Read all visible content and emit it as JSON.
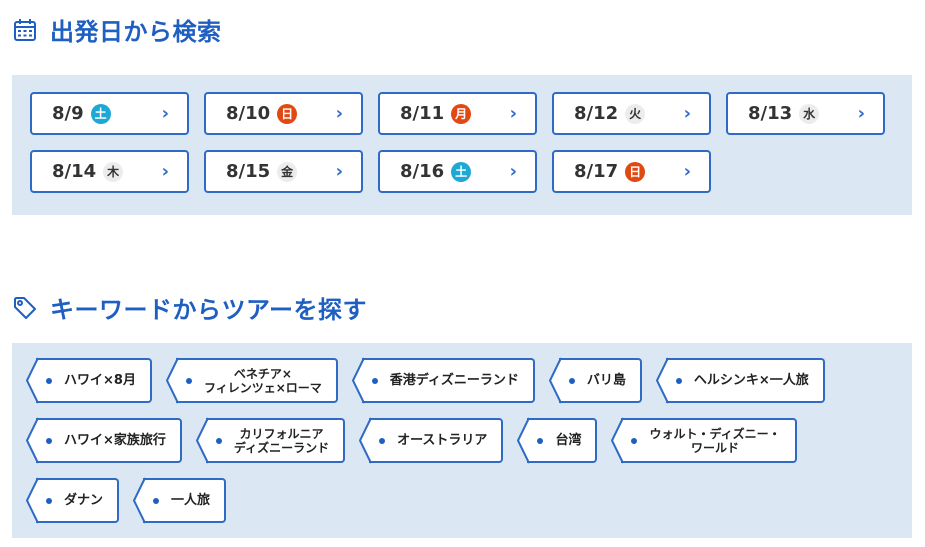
{
  "date_section": {
    "title": "出発日から検索",
    "icon": "calendar-icon",
    "dates": [
      {
        "date": "8/9",
        "dow": "土",
        "type": "sat"
      },
      {
        "date": "8/10",
        "dow": "日",
        "type": "sun"
      },
      {
        "date": "8/11",
        "dow": "月",
        "type": "sun"
      },
      {
        "date": "8/12",
        "dow": "火",
        "type": "wk"
      },
      {
        "date": "8/13",
        "dow": "水",
        "type": "wk"
      },
      {
        "date": "8/14",
        "dow": "木",
        "type": "wk"
      },
      {
        "date": "8/15",
        "dow": "金",
        "type": "wk"
      },
      {
        "date": "8/16",
        "dow": "土",
        "type": "sat"
      },
      {
        "date": "8/17",
        "dow": "日",
        "type": "sun"
      }
    ],
    "chevron": "›"
  },
  "keyword_section": {
    "title": "キーワードからツアーを探す",
    "icon": "tag-icon",
    "rows": [
      [
        "ハワイ×8月",
        "ベネチア×\nフィレンツェ×ローマ",
        "香港ディズニーランド",
        "バリ島",
        "ヘルシンキ×一人旅"
      ],
      [
        "ハワイ×家族旅行",
        "カリフォルニア\nディズニーランド",
        "オーストラリア",
        "台湾",
        "ウォルト・ディズニー・\nワールド"
      ],
      [
        "ダナン",
        "一人旅"
      ]
    ]
  },
  "colors": {
    "accent": "#1f5fc2",
    "border": "#2f6bc5",
    "panel_bg": "#dbe8f3",
    "saturday": "#1ea8d6",
    "holiday": "#e04a12"
  }
}
